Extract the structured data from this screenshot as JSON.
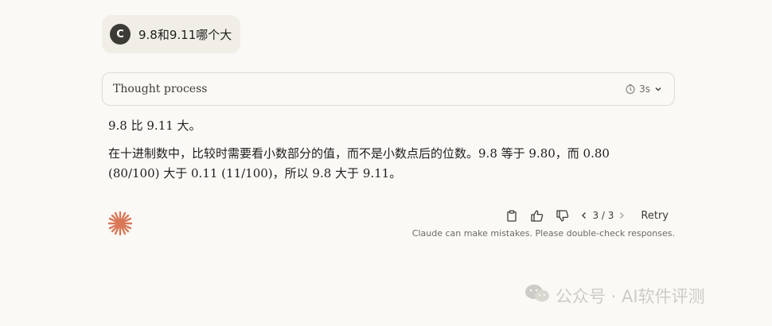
{
  "user_message": {
    "avatar_initial": "C",
    "text": "9.8和9.11哪个大"
  },
  "thought": {
    "label": "Thought process",
    "duration": "3s",
    "icons": [
      "timer-icon",
      "chevron-down-icon"
    ]
  },
  "answer": {
    "p1": "9.8 比 9.11 大。",
    "p2": "在十进制数中，比较时需要看小数部分的值，而不是小数点后的位数。9.8 等于 9.80，而 0.80 (80/100) 大于 0.11 (11/100)，所以 9.8 大于 9.11。"
  },
  "actions": {
    "icons": [
      "copy-icon",
      "thumbs-up-icon",
      "thumbs-down-icon",
      "chevron-left-icon",
      "chevron-right-icon"
    ],
    "pager": "3 / 3",
    "retry": "Retry"
  },
  "disclaimer": "Claude can make mistakes. Please double-check responses.",
  "watermark": "公众号 · AI软件评测",
  "colors": {
    "background": "#faf9f5",
    "bubble": "#f0eee6",
    "avatar": "#3d3b35",
    "brand": "#d97757",
    "text": "#1f1e1d",
    "muted": "#6b6a64"
  }
}
